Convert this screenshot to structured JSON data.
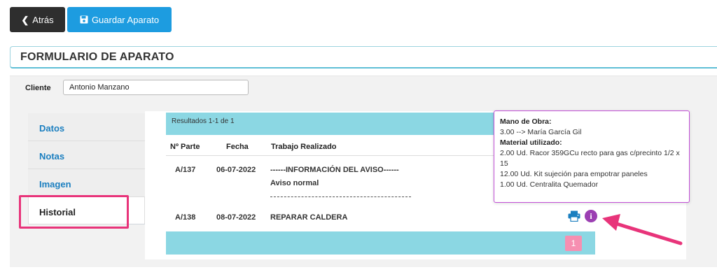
{
  "toolbar": {
    "back_label": "Atrás",
    "save_label": "Guardar Aparato"
  },
  "page": {
    "title": "FORMULARIO DE APARATO"
  },
  "client": {
    "label": "Cliente",
    "value": "Antonio Manzano"
  },
  "tabs": [
    {
      "label": "Datos"
    },
    {
      "label": "Notas"
    },
    {
      "label": "Imagen"
    },
    {
      "label": "Historial",
      "active": true
    }
  ],
  "history": {
    "results_text": "Resultados 1-1 de 1",
    "columns": {
      "parte": "Nº Parte",
      "fecha": "Fecha",
      "trabajo": "Trabajo Realizado"
    },
    "rows": [
      {
        "parte": "A/137",
        "fecha": "06-07-2022",
        "trabajo_line1": "------INFORMACIÓN DEL AVISO------",
        "trabajo_line2": "Aviso normal"
      },
      {
        "parte": "A/138",
        "fecha": "08-07-2022",
        "trabajo_line1": "REPARAR CALDERA"
      }
    ],
    "pager": {
      "current_page": "1"
    }
  },
  "tooltip": {
    "labor_title": "Mano de Obra:",
    "labor_line": "3.00 --> María García Gil",
    "material_title": "Material utilizado:",
    "material_lines": [
      "2.00 Ud. Racor 359GCu recto para gas c/precinto 1/2 x 15",
      "12.00 Ud. Kit sujeción para empotrar paneles",
      "1.00 Ud. Centralita Quemador"
    ]
  },
  "icons": {
    "back": "chevron-left-icon",
    "save": "floppy-disk-icon",
    "print": "printer-icon",
    "info": "info-circle-icon"
  },
  "colors": {
    "accent": "#1d9ce0",
    "table_bar": "#8bd7e3",
    "highlight": "#e8347a",
    "info": "#9b3fb2",
    "page_button": "#f68fb1"
  }
}
